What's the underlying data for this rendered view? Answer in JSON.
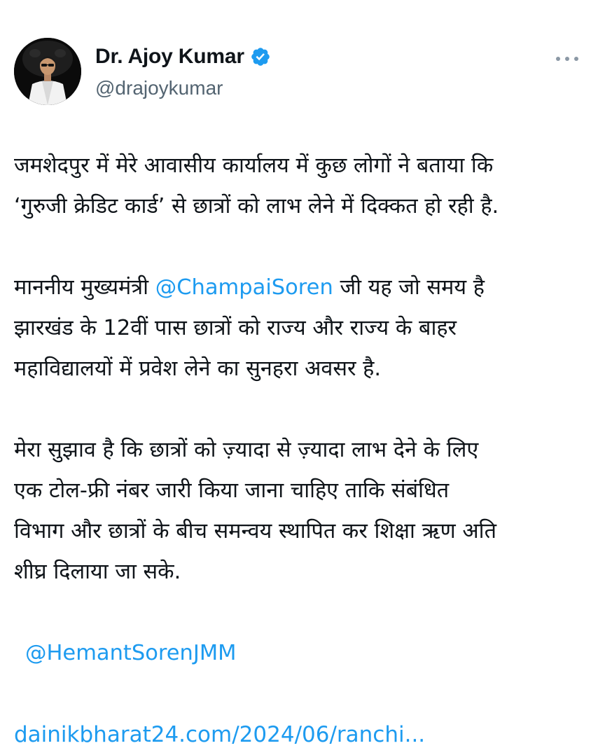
{
  "tweet": {
    "author": {
      "display_name": "Dr. Ajoy Kumar",
      "handle": "@drajoykumar",
      "verified": true,
      "avatar_icon": "profile-photo-icon"
    },
    "more_icon": "more-options-icon",
    "paragraph1": {
      "line1": "जमशेदपुर में मेरे आवासीय कार्यालय में कुछ लोगों ने बताया कि",
      "line2": "‘गुरुजी क्रेडिट कार्ड’ से छात्रों को लाभ लेने में दिक्कत हो रही है."
    },
    "paragraph2": {
      "line1_pre": "माननीय मुख्यमंत्री ",
      "mention": "@ChampaiSoren",
      "line1_post": " जी यह जो समय है",
      "line2": "झारखंड के 12वीं पास छात्रों को राज्य और राज्य के बाहर",
      "line3": "महाविद्यालयों में प्रवेश लेने का सुनहरा अवसर है."
    },
    "paragraph3": {
      "line1": "मेरा सुझाव है कि छात्रों को ज़्यादा से ज़्यादा लाभ देने के लिए",
      "line2": "एक टोल-फ्री नंबर जारी किया जाना चाहिए ताकि संबंधित",
      "line3": "विभाग और छात्रों के बीच समन्वय स्थापित कर शिक्षा ऋण अति",
      "line4": "शीघ्र दिलाया जा सके."
    },
    "mention2": "@HemantSorenJMM",
    "link": "dainikbharat24.com/2024/06/ranchi..."
  },
  "colors": {
    "text": "#0f1419",
    "secondary": "#536471",
    "accent": "#1d9bf0"
  }
}
